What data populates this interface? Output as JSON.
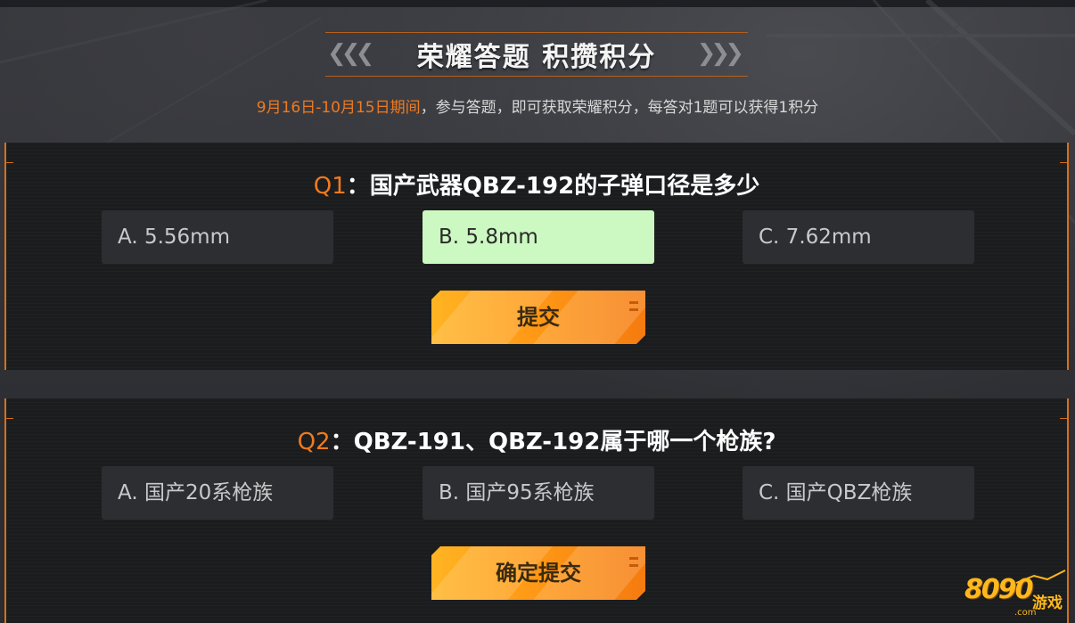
{
  "header": {
    "title": "荣耀答题 积攒积分",
    "subtitle_date": "9月16日-10月15日期间",
    "subtitle_text": "，参与答题，即可获取荣耀积分，每答对1题可以获得1积分"
  },
  "questions": [
    {
      "number": "Q1",
      "sep": "：",
      "text": "国产武器QBZ-192的子弹口径是多少",
      "options": [
        {
          "label": "A. 5.56mm",
          "selected": false
        },
        {
          "label": "B. 5.8mm",
          "selected": true
        },
        {
          "label": "C. 7.62mm",
          "selected": false
        }
      ],
      "button_label": "提交"
    },
    {
      "number": "Q2",
      "sep": "：",
      "text": "QBZ-191、QBZ-192属于哪一个枪族?",
      "options": [
        {
          "label": "A. 国产20系枪族",
          "selected": false
        },
        {
          "label": "B. 国产95系枪族",
          "selected": false
        },
        {
          "label": "C. 国产QBZ枪族",
          "selected": false
        }
      ],
      "button_label": "确定提交"
    }
  ],
  "watermark": {
    "number": "8090",
    "text": "游戏",
    "domain": ".com"
  },
  "colors": {
    "accent": "#f07a1e",
    "selected_option": "#ccf9c2",
    "button": "#ff9a16"
  }
}
